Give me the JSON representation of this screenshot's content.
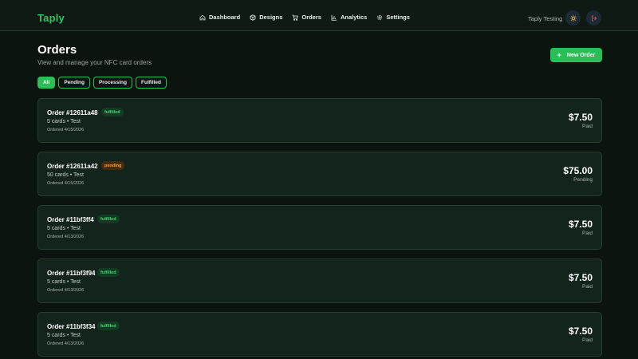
{
  "brand": "Taply",
  "nav": [
    {
      "label": "Dashboard",
      "icon": "home-icon"
    },
    {
      "label": "Designs",
      "icon": "cube-icon"
    },
    {
      "label": "Orders",
      "icon": "cart-icon"
    },
    {
      "label": "Analytics",
      "icon": "bar-chart-icon"
    },
    {
      "label": "Settings",
      "icon": "gear-icon"
    }
  ],
  "user": {
    "name": "Taply Testing"
  },
  "header": {
    "title": "Orders",
    "subtitle": "View and manage your NFC card orders",
    "new_order_label": "New Order"
  },
  "filters": [
    "All",
    "Pending",
    "Processing",
    "Fulfilled"
  ],
  "active_filter": "All",
  "orders": [
    {
      "id": "Order #12611a48",
      "status": "fulfilled",
      "desc": "5 cards • Test",
      "date": "Ordered 4/15/2026",
      "price": "$7.50",
      "payment": "Paid"
    },
    {
      "id": "Order #12611a42",
      "status": "pending",
      "desc": "50 cards • Test",
      "date": "Ordered 4/15/2026",
      "price": "$75.00",
      "payment": "Pending"
    },
    {
      "id": "Order #11bf3ff4",
      "status": "fulfilled",
      "desc": "5 cards • Test",
      "date": "Ordered 4/13/2026",
      "price": "$7.50",
      "payment": "Paid"
    },
    {
      "id": "Order #11bf3f94",
      "status": "fulfilled",
      "desc": "5 cards • Test",
      "date": "Ordered 4/13/2026",
      "price": "$7.50",
      "payment": "Paid"
    },
    {
      "id": "Order #11bf3f34",
      "status": "fulfilled",
      "desc": "5 cards • Test",
      "date": "Ordered 4/13/2026",
      "price": "$7.50",
      "payment": "Paid"
    }
  ],
  "colors": {
    "accent": "#28c056",
    "background": "#0c1410",
    "card": "#13241b",
    "pending": "#f0a23b"
  }
}
